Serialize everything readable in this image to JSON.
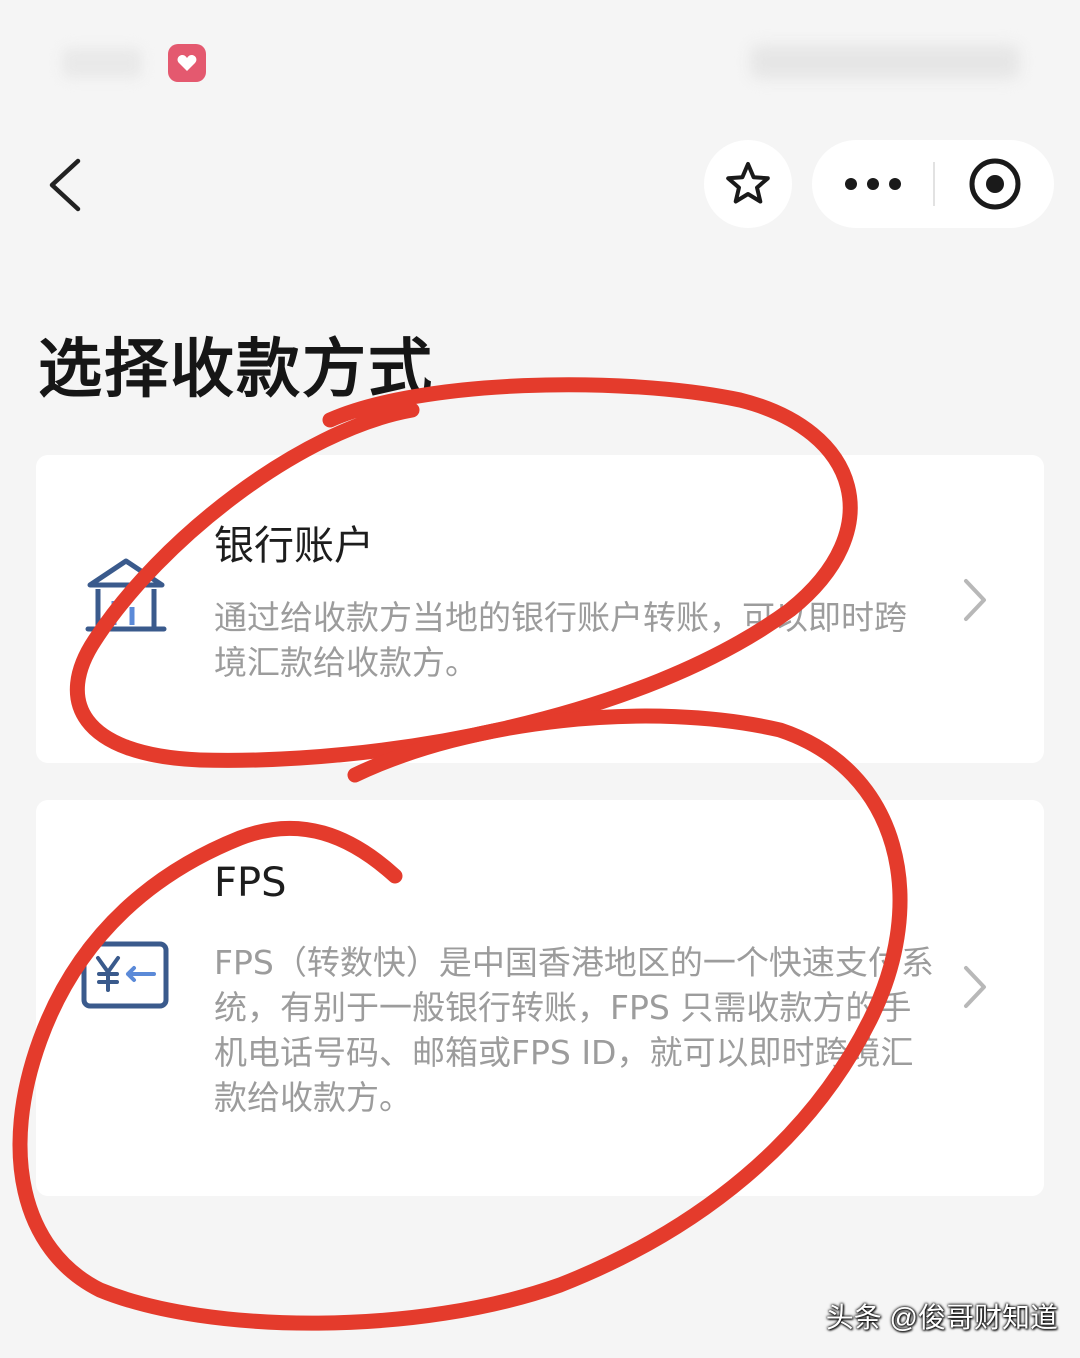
{
  "page": {
    "title": "选择收款方式"
  },
  "options": [
    {
      "title": "银行账户",
      "description": "通过给收款方当地的银行账户转账，可以即时跨境汇款给收款方。",
      "icon": "bank-icon"
    },
    {
      "title": "FPS",
      "description": "FPS（转数快）是中国香港地区的一个快速支付系统，有别于一般银行转账，FPS 只需收款方的手机电话号码、邮箱或FPS ID，就可以即时跨境汇款给收款方。",
      "icon": "fps-icon"
    }
  ],
  "watermark": "头条 @俊哥财知道",
  "colors": {
    "accent": "#3a5a8c",
    "annotation": "#e43b2c",
    "background": "#f5f5f5"
  }
}
